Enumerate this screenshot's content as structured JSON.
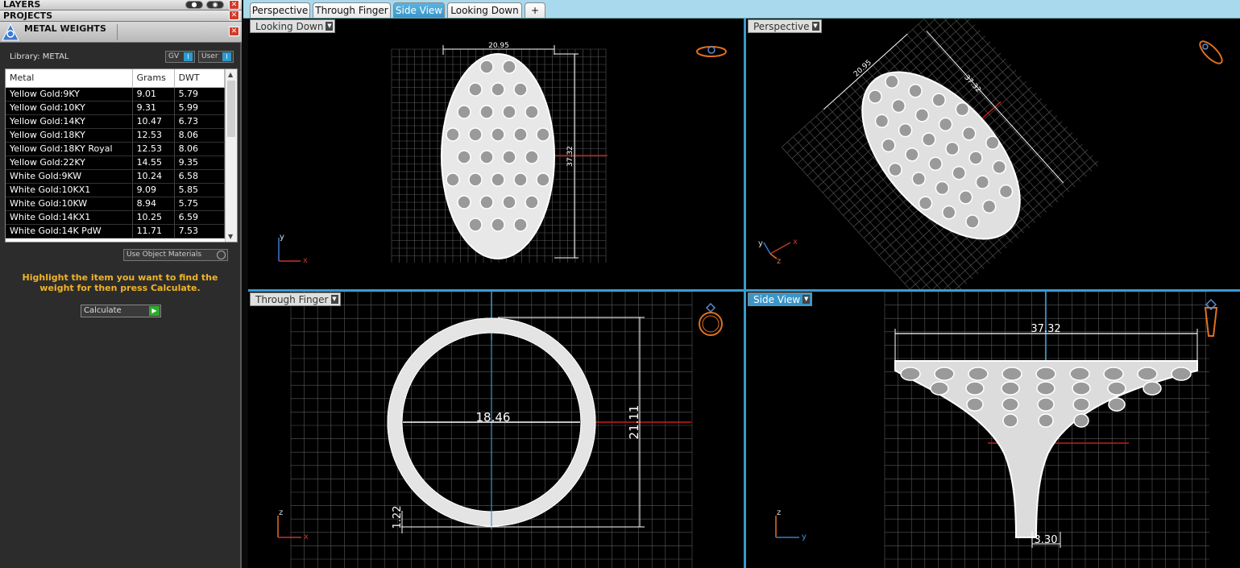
{
  "panels": {
    "layers_title": "LAYERS",
    "projects_title": "PROJECTS",
    "metal_weights_title": "METAL WEIGHTS",
    "close_glyph": "✕",
    "layers_toggle_on": "●",
    "layers_toggle_eye": "◉"
  },
  "metal": {
    "library_label": "Library: METAL",
    "gv_label": "GV",
    "user_label": "User",
    "toggle_glyph": "I",
    "columns": [
      "Metal",
      "Grams",
      "DWT"
    ],
    "rows": [
      {
        "metal": "Yellow Gold:9KY",
        "grams": "9.01",
        "dwt": "5.79"
      },
      {
        "metal": "Yellow Gold:10KY",
        "grams": "9.31",
        "dwt": "5.99"
      },
      {
        "metal": "Yellow Gold:14KY",
        "grams": "10.47",
        "dwt": "6.73"
      },
      {
        "metal": "Yellow Gold:18KY",
        "grams": "12.53",
        "dwt": "8.06"
      },
      {
        "metal": "Yellow Gold:18KY Royal",
        "grams": "12.53",
        "dwt": "8.06"
      },
      {
        "metal": "Yellow Gold:22KY",
        "grams": "14.55",
        "dwt": "9.35"
      },
      {
        "metal": "White Gold:9KW",
        "grams": "10.24",
        "dwt": "6.58"
      },
      {
        "metal": "White Gold:10KX1",
        "grams": "9.09",
        "dwt": "5.85"
      },
      {
        "metal": "White Gold:10KW",
        "grams": "8.94",
        "dwt": "5.75"
      },
      {
        "metal": "White Gold:14KX1",
        "grams": "10.25",
        "dwt": "6.59"
      },
      {
        "metal": "White Gold:14K PdW",
        "grams": "11.71",
        "dwt": "7.53"
      }
    ],
    "use_object_materials": "Use Object Materials",
    "hint": "Highlight the item you want to find the weight for then press Calculate.",
    "calculate": "Calculate",
    "play_glyph": "▶",
    "scroll_up": "▲",
    "scroll_down": "▼"
  },
  "tabs": [
    {
      "label": "Perspective",
      "active": false
    },
    {
      "label": "Through Finger",
      "active": false
    },
    {
      "label": "Side View",
      "active": true
    },
    {
      "label": "Looking Down",
      "active": false
    }
  ],
  "add_tab_glyph": "+",
  "dropdown_glyph": "▼",
  "viewports": {
    "looking_down": {
      "label": "Looking Down",
      "width_dim": "20.95",
      "height_dim": "37.32"
    },
    "perspective": {
      "label": "Perspective",
      "width_dim": "20.95",
      "height_dim": "37.32"
    },
    "through_finger": {
      "label": "Through Finger",
      "inner_dim": "18.46",
      "height_dim": "21.11",
      "thickness_dim": "1.22"
    },
    "side_view": {
      "label": "Side View",
      "top_dim": "37.32",
      "bottom_dim": "3.30"
    }
  },
  "axes": {
    "x": "x",
    "y": "y",
    "z": "z"
  },
  "colors": {
    "accent": "#3a96c8",
    "hint": "#f0b428",
    "redline": "#c0201a",
    "axis_red": "#c0392b",
    "axis_blue": "#3a7ad0",
    "axis_orange": "#e07020"
  }
}
